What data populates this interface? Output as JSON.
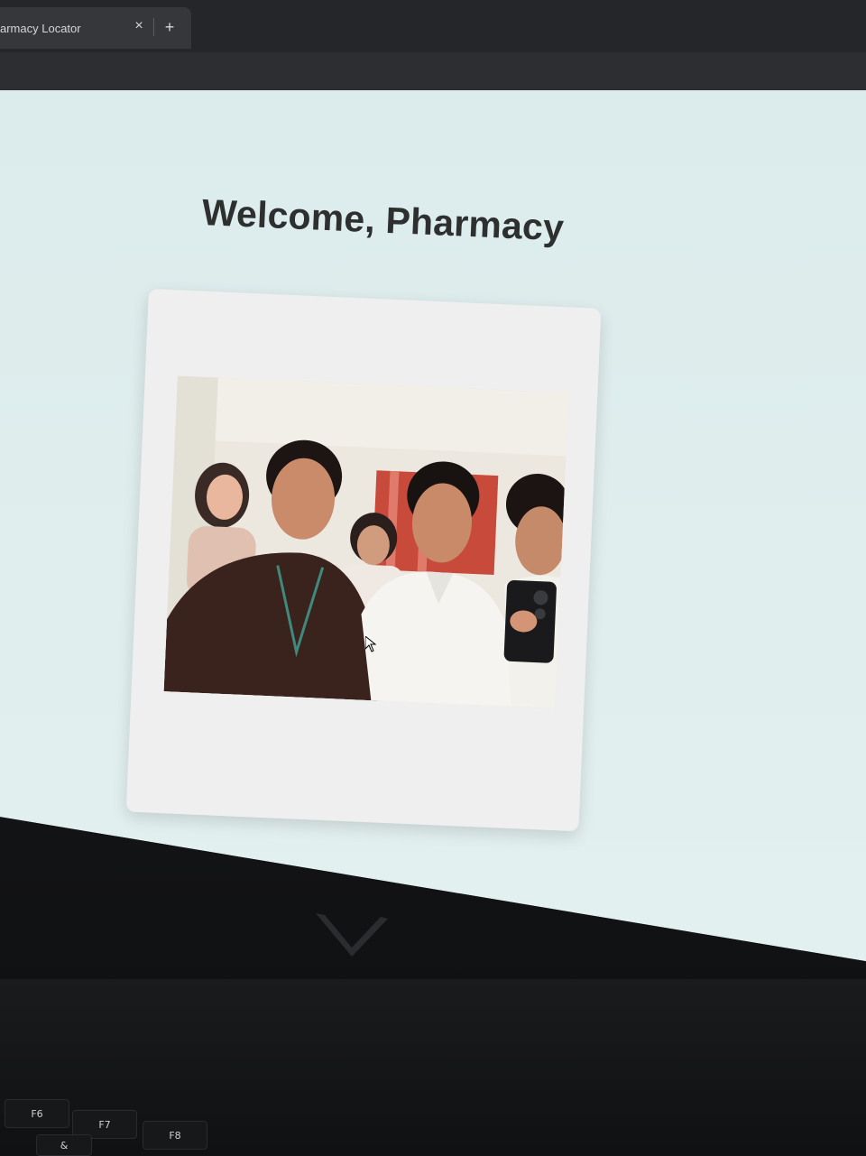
{
  "browser": {
    "tab_title": "armacy Locator",
    "tab_close": "×",
    "new_tab": "+"
  },
  "page": {
    "title": "Welcome, Pharmacy"
  },
  "photo": {
    "alt_visible": false
  },
  "keyboard": {
    "keys": [
      "F6",
      "F7",
      "F8",
      "&"
    ]
  },
  "colors": {
    "page_bg": "#dcebeb",
    "card_bg": "#efefef",
    "title_text": "#2e302f",
    "tab_bg": "#35373b"
  },
  "icons": [
    "close-icon",
    "plus-icon",
    "cursor-icon",
    "hinge-logo-icon"
  ]
}
